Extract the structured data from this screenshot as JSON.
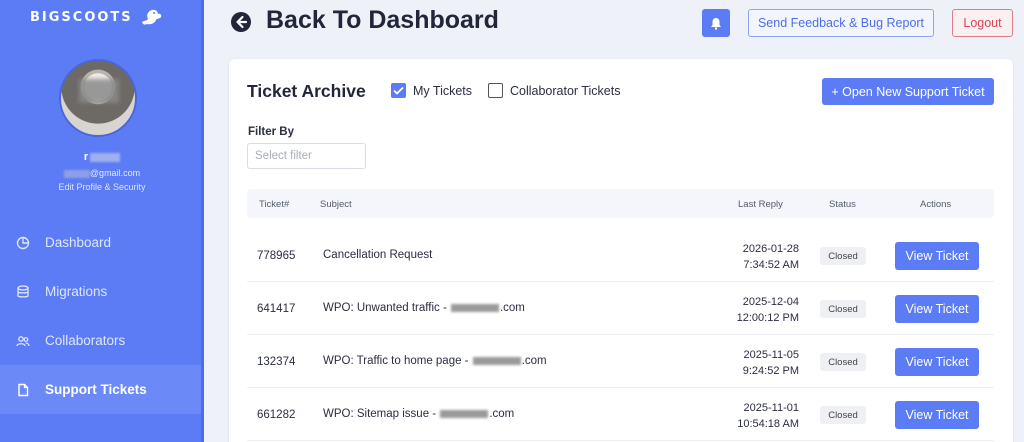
{
  "sidebar": {
    "brand": "BIGSCOOTS",
    "user_name": "r",
    "user_email": "@gmail.com",
    "edit_profile": "Edit Profile & Security",
    "items": [
      {
        "label": "Dashboard",
        "icon": "pie-chart-icon"
      },
      {
        "label": "Migrations",
        "icon": "database-icon"
      },
      {
        "label": "Collaborators",
        "icon": "users-icon"
      },
      {
        "label": "Support Tickets",
        "icon": "ticket-icon",
        "active": true
      }
    ]
  },
  "header": {
    "title": "Back To Dashboard",
    "feedback": "Send Feedback & Bug Report",
    "logout": "Logout"
  },
  "archive": {
    "title": "Ticket Archive",
    "my_tickets": {
      "label": "My Tickets",
      "checked": true
    },
    "collab_tickets": {
      "label": "Collaborator Tickets",
      "checked": false
    },
    "open_ticket": "+ Open New Support Ticket",
    "filter_label": "Filter By",
    "filter_placeholder": "Select filter"
  },
  "table": {
    "columns": [
      "Ticket#",
      "Subject",
      "Last Reply",
      "Status",
      "Actions"
    ],
    "rows": [
      {
        "id": "778965",
        "subject": "Cancellation Request",
        "subject_suffix": "",
        "date": "2026-01-28",
        "time": "7:34:52 AM",
        "status": "Closed",
        "action": "View Ticket"
      },
      {
        "id": "641417",
        "subject": "WPO: Unwanted traffic - ",
        "subject_suffix": ".com",
        "date": "2025-12-04",
        "time": "12:00:12 PM",
        "status": "Closed",
        "action": "View Ticket"
      },
      {
        "id": "132374",
        "subject": "WPO: Traffic to home page - ",
        "subject_suffix": ".com",
        "date": "2025-11-05",
        "time": "9:24:52 PM",
        "status": "Closed",
        "action": "View Ticket"
      },
      {
        "id": "661282",
        "subject": "WPO: Sitemap issue - ",
        "subject_suffix": ".com",
        "date": "2025-11-01",
        "time": "10:54:18 AM",
        "status": "Closed",
        "action": "View Ticket"
      }
    ]
  },
  "colors": {
    "accent": "#5b7cf5",
    "logout": "#d64556",
    "title": "#23263a"
  }
}
